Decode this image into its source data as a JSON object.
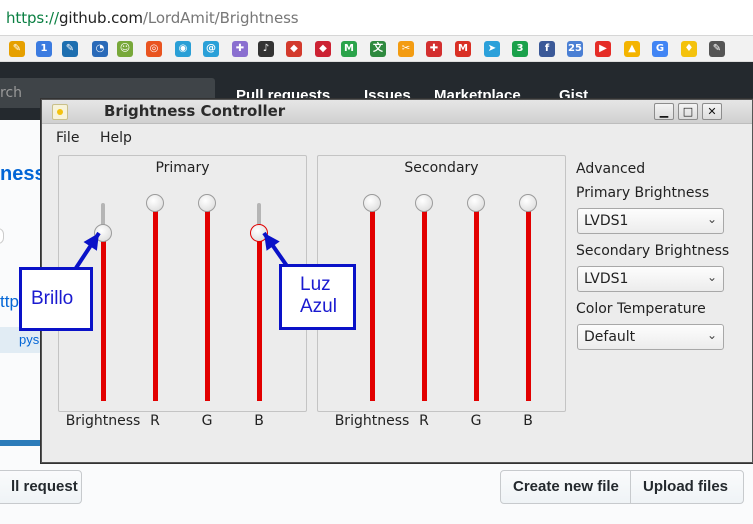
{
  "browser": {
    "url_scheme": "https://",
    "url_host": "github.com",
    "url_path": "/LordAmit/Brightness",
    "bookmarks": [
      {
        "icon": "extension-icon",
        "color": "#e6a000",
        "glyph": "✎"
      },
      {
        "icon": "calendar-icon",
        "color": "#3b7be0",
        "glyph": "1"
      },
      {
        "icon": "edit-icon",
        "color": "#1e6fb0",
        "glyph": "✎"
      },
      {
        "icon": "speedometer-icon",
        "color": "#2a6ab8",
        "glyph": "◔"
      },
      {
        "icon": "android-icon",
        "color": "#78a83a",
        "glyph": "☺"
      },
      {
        "icon": "ubuntu-icon",
        "color": "#e95420",
        "glyph": "◎"
      },
      {
        "icon": "cd-icon",
        "color": "#2a9fd6",
        "glyph": "◉"
      },
      {
        "icon": "debian-icon",
        "color": "#2aa0d8",
        "glyph": "@"
      },
      {
        "icon": "puzzle-icon",
        "color": "#8a6fd0",
        "glyph": "✚"
      },
      {
        "icon": "microphone-icon",
        "color": "#333333",
        "glyph": "♪"
      },
      {
        "icon": "shield-icon",
        "color": "#d33a2c",
        "glyph": "◆"
      },
      {
        "icon": "ruby-icon",
        "color": "#cc2233",
        "glyph": "◆"
      },
      {
        "icon": "m-logo-icon",
        "color": "#2aa34a",
        "glyph": "M"
      },
      {
        "icon": "translate-icon",
        "color": "#2f8a3f",
        "glyph": "文"
      },
      {
        "icon": "scissors-icon",
        "color": "#f39c12",
        "glyph": "✂"
      },
      {
        "icon": "bookmark-icon",
        "color": "#d32f2f",
        "glyph": "✚"
      },
      {
        "icon": "gmail-icon",
        "color": "#d93025",
        "glyph": "M"
      },
      {
        "icon": "telegram-icon",
        "color": "#2ba0da",
        "glyph": "➤"
      },
      {
        "icon": "counter-icon",
        "color": "#1aa14b",
        "glyph": "3"
      },
      {
        "icon": "facebook-icon",
        "color": "#3b5998",
        "glyph": "f"
      },
      {
        "icon": "date-icon",
        "color": "#4a7fd4",
        "glyph": "25"
      },
      {
        "icon": "youtube-icon",
        "color": "#e52d27",
        "glyph": "▶"
      },
      {
        "icon": "drive-icon",
        "color": "#f4b400",
        "glyph": "▲"
      },
      {
        "icon": "google-translate-icon",
        "color": "#4285f4",
        "glyph": "G"
      },
      {
        "icon": "lightbulb-icon",
        "color": "#f4c20d",
        "glyph": "♦"
      },
      {
        "icon": "pen-icon",
        "color": "#555555",
        "glyph": "✎"
      }
    ]
  },
  "github": {
    "search_placeholder": "rch",
    "nav": [
      "Pull requests",
      "Issues",
      "Marketplace",
      "Gist"
    ],
    "repo_title_fragment": "ness",
    "link_fragment": "ttp",
    "topic_fragment": "pys",
    "pull_request_button": "ll request",
    "create_file_button": "Create new file",
    "upload_files_button": "Upload files"
  },
  "window": {
    "title": "Brightness Controller",
    "controls": {
      "minimize": "▁",
      "maximize": "□",
      "close": "✕"
    },
    "menu": [
      "File",
      "Help"
    ],
    "primary": {
      "title": "Primary",
      "sliders": [
        {
          "label": "Brightness",
          "level": 0.85,
          "focused": false
        },
        {
          "label": "R",
          "level": 1.0,
          "focused": false
        },
        {
          "label": "G",
          "level": 1.0,
          "focused": false
        },
        {
          "label": "B",
          "level": 0.85,
          "focused": true
        }
      ]
    },
    "secondary": {
      "title": "Secondary",
      "sliders": [
        {
          "label": "Brightness",
          "level": 1.0,
          "focused": false
        },
        {
          "label": "R",
          "level": 1.0,
          "focused": false
        },
        {
          "label": "G",
          "level": 1.0,
          "focused": false
        },
        {
          "label": "B",
          "level": 1.0,
          "focused": false
        }
      ]
    },
    "advanced": {
      "heading": "Advanced",
      "primary_label": "Primary Brightness",
      "primary_value": "LVDS1",
      "secondary_label": "Secondary Brightness",
      "secondary_value": "LVDS1",
      "color_temp_label": "Color Temperature",
      "color_temp_value": "Default"
    }
  },
  "annotations": {
    "brillo": "Brillo",
    "luz_line1": "Luz",
    "luz_line2": "Azul",
    "color": "#0a12c8"
  }
}
